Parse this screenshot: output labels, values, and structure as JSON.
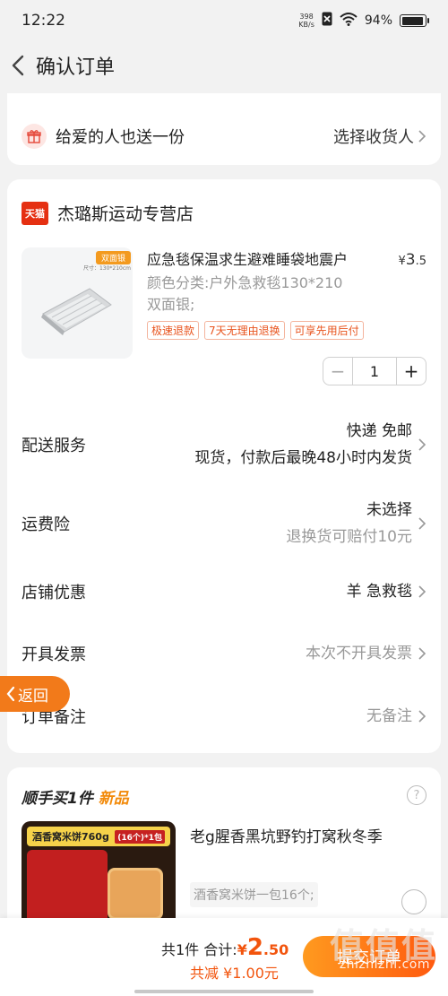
{
  "status": {
    "time": "12:22",
    "net_speed_value": "398",
    "net_speed_unit": "KB/s",
    "battery": "94%",
    "battery_level": 0.94
  },
  "nav": {
    "title": "确认订单"
  },
  "gift": {
    "label": "给爱的人也送一份",
    "action": "选择收货人"
  },
  "store": {
    "logo_text": "天猫",
    "name": "杰璐斯运动专营店"
  },
  "product": {
    "img_tag": "双面银",
    "img_tag_sub": "尺寸：130*210cm",
    "title": "应急毯保温求生避难睡袋地震户",
    "price_symbol": "¥",
    "price_int": "3",
    "price_dec": ".5",
    "spec_line1": "颜色分类:户外急救毯130*210",
    "spec_line2": "双面银;",
    "badges": [
      "极速退款",
      "7天无理由退换",
      "可享先用后付"
    ],
    "quantity": "1"
  },
  "options": {
    "delivery": {
      "label": "配送服务",
      "line1": "快递 免邮",
      "line2": "现货，付款后最晚48小时内发货"
    },
    "insurance": {
      "label": "运费险",
      "line1": "未选择",
      "line2": "退换货可赔付10元"
    },
    "coupon": {
      "label": "店铺优惠",
      "value": "羊  急救毯"
    },
    "invoice": {
      "label": "开具发票",
      "value": "本次不开具发票"
    },
    "note": {
      "label": "订单备注",
      "value": "无备注"
    }
  },
  "return_button": "返回",
  "recommend": {
    "head_main": "顺手买1件 ",
    "head_new": "新品",
    "img_label": "酒香窝米饼760g",
    "img_pack": "(16个)*1包",
    "title": "老g腥香黑坑野钓打窝秋冬季",
    "desc": "酒香窝米饼一包16个;"
  },
  "footer": {
    "count": "共1件",
    "total_label": "合计:",
    "currency": "¥",
    "total_int": "2",
    "total_dec": ".50",
    "discount": "共减 ¥1.00元",
    "submit": "提交订单",
    "watermark": "zhizhizhi.com",
    "watermark_big": "值值值"
  },
  "colors": {
    "accent": "#f2540d",
    "orange_btn": "#f27a1a",
    "tmall_red": "#e53012"
  }
}
